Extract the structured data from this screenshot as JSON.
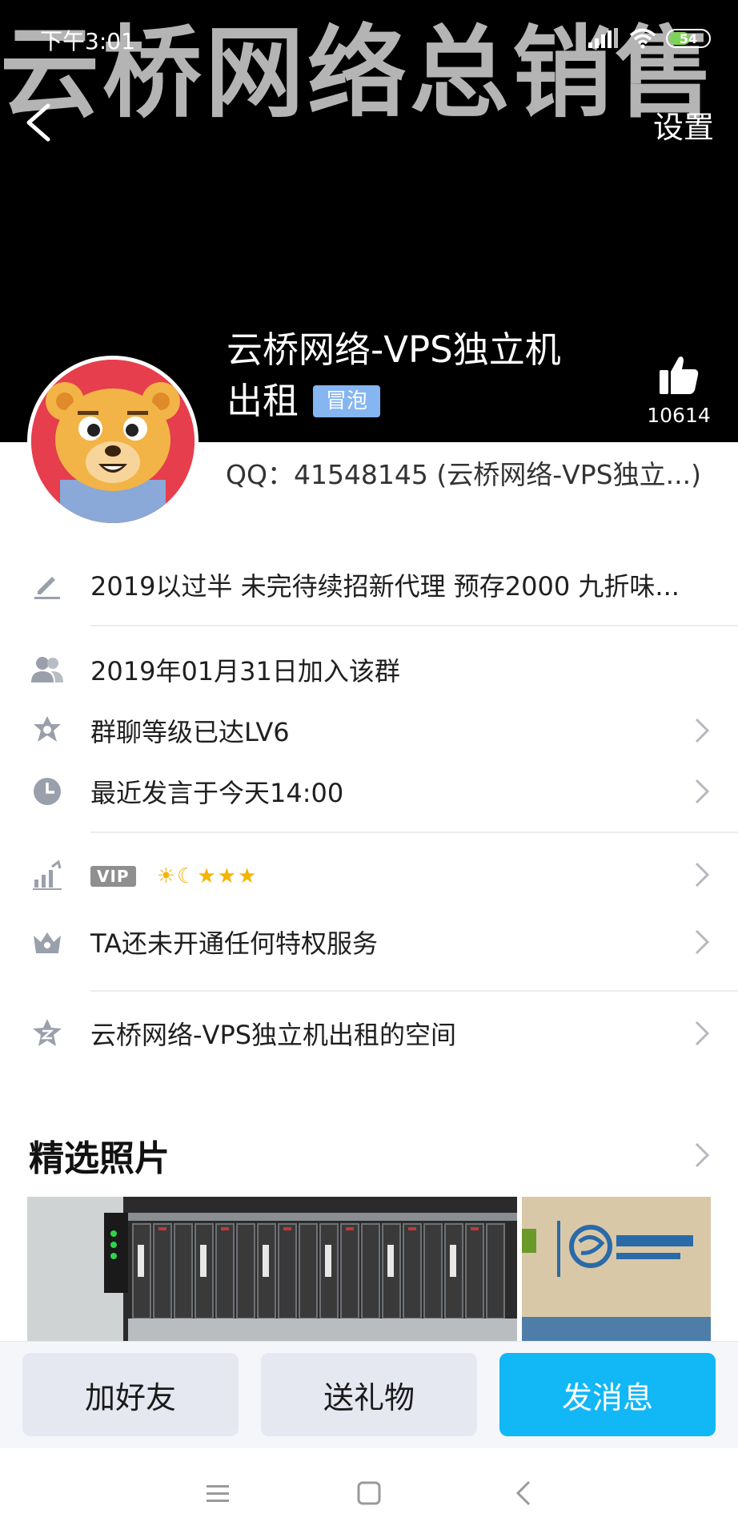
{
  "status_bar": {
    "time": "下午3:01",
    "battery": "54",
    "battery_level": 0.54
  },
  "header": {
    "cover_text": "云桥网络总销售",
    "settings_label": "设置",
    "group_name_line1": "云桥网络-VPS独立机",
    "group_name_line2": "出租",
    "tag": "冒泡",
    "like_count": "10614",
    "qq_line": "QQ：41548145 (云桥网络-VPS独立...)"
  },
  "info": {
    "intro": "2019以过半 未完待续招新代理 预存2000 九折味...",
    "join_date": "2019年01月31日加入该群",
    "group_level": "群聊等级已达LV6",
    "last_speak": "最近发言于今天14:00",
    "vip_label": "VIP",
    "vip_levels": "☀☾★★★",
    "privilege": "TA还未开通任何特权服务",
    "space": "云桥网络-VPS独立机出租的空间"
  },
  "photos": {
    "title": "精选照片"
  },
  "actions": {
    "add_friend": "加好友",
    "send_gift": "送礼物",
    "send_message": "发消息"
  },
  "colors": {
    "accent": "#12b7f5",
    "tag_bg": "#86b6f2",
    "avatar_bg": "#e63e4d",
    "cover_bg": "#000000"
  }
}
